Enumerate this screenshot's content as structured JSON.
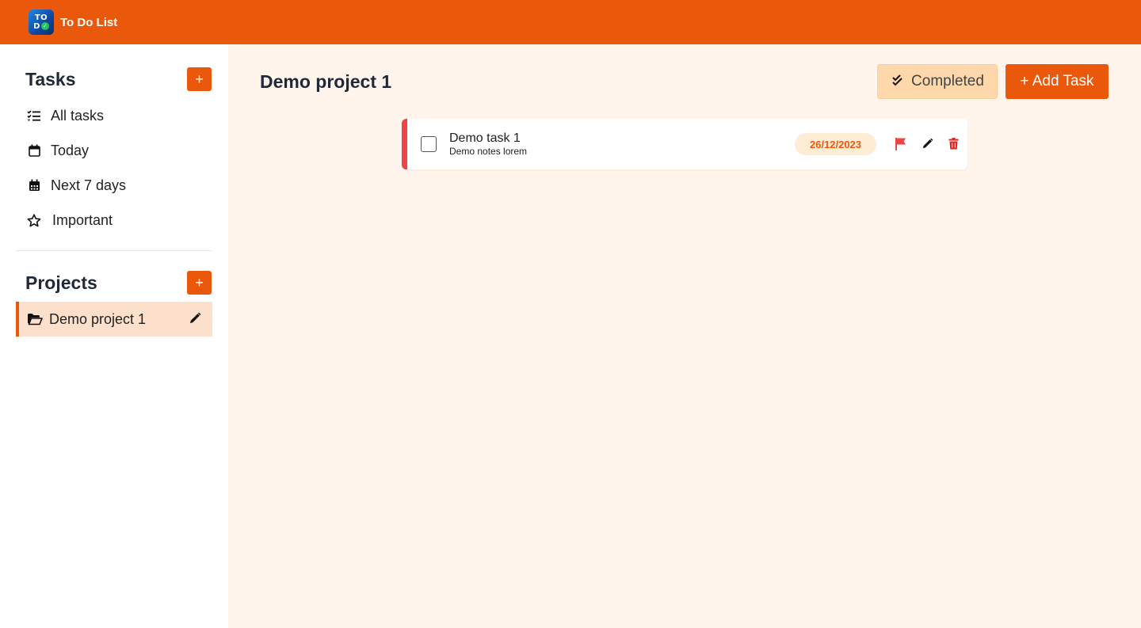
{
  "app": {
    "title": "To Do List",
    "logo_top": "TO",
    "logo_bottom": "D",
    "accent": "#ea580c"
  },
  "sidebar": {
    "tasks_title": "Tasks",
    "add_label": "+",
    "items": [
      {
        "label": "All tasks",
        "icon": "list-check-icon"
      },
      {
        "label": "Today",
        "icon": "calendar-icon"
      },
      {
        "label": "Next 7 days",
        "icon": "calendar-week-icon"
      },
      {
        "label": "Important",
        "icon": "star-icon"
      }
    ],
    "projects_title": "Projects",
    "projects": [
      {
        "label": "Demo project 1",
        "icon": "folder-open-icon",
        "active": true
      }
    ]
  },
  "main": {
    "title": "Demo project 1",
    "completed_label": "Completed",
    "add_task_label": "+ Add Task",
    "tasks": [
      {
        "title": "Demo task 1",
        "notes": "Demo notes lorem",
        "date": "26/12/2023",
        "priority_color": "#ef4444",
        "done": false
      }
    ]
  }
}
